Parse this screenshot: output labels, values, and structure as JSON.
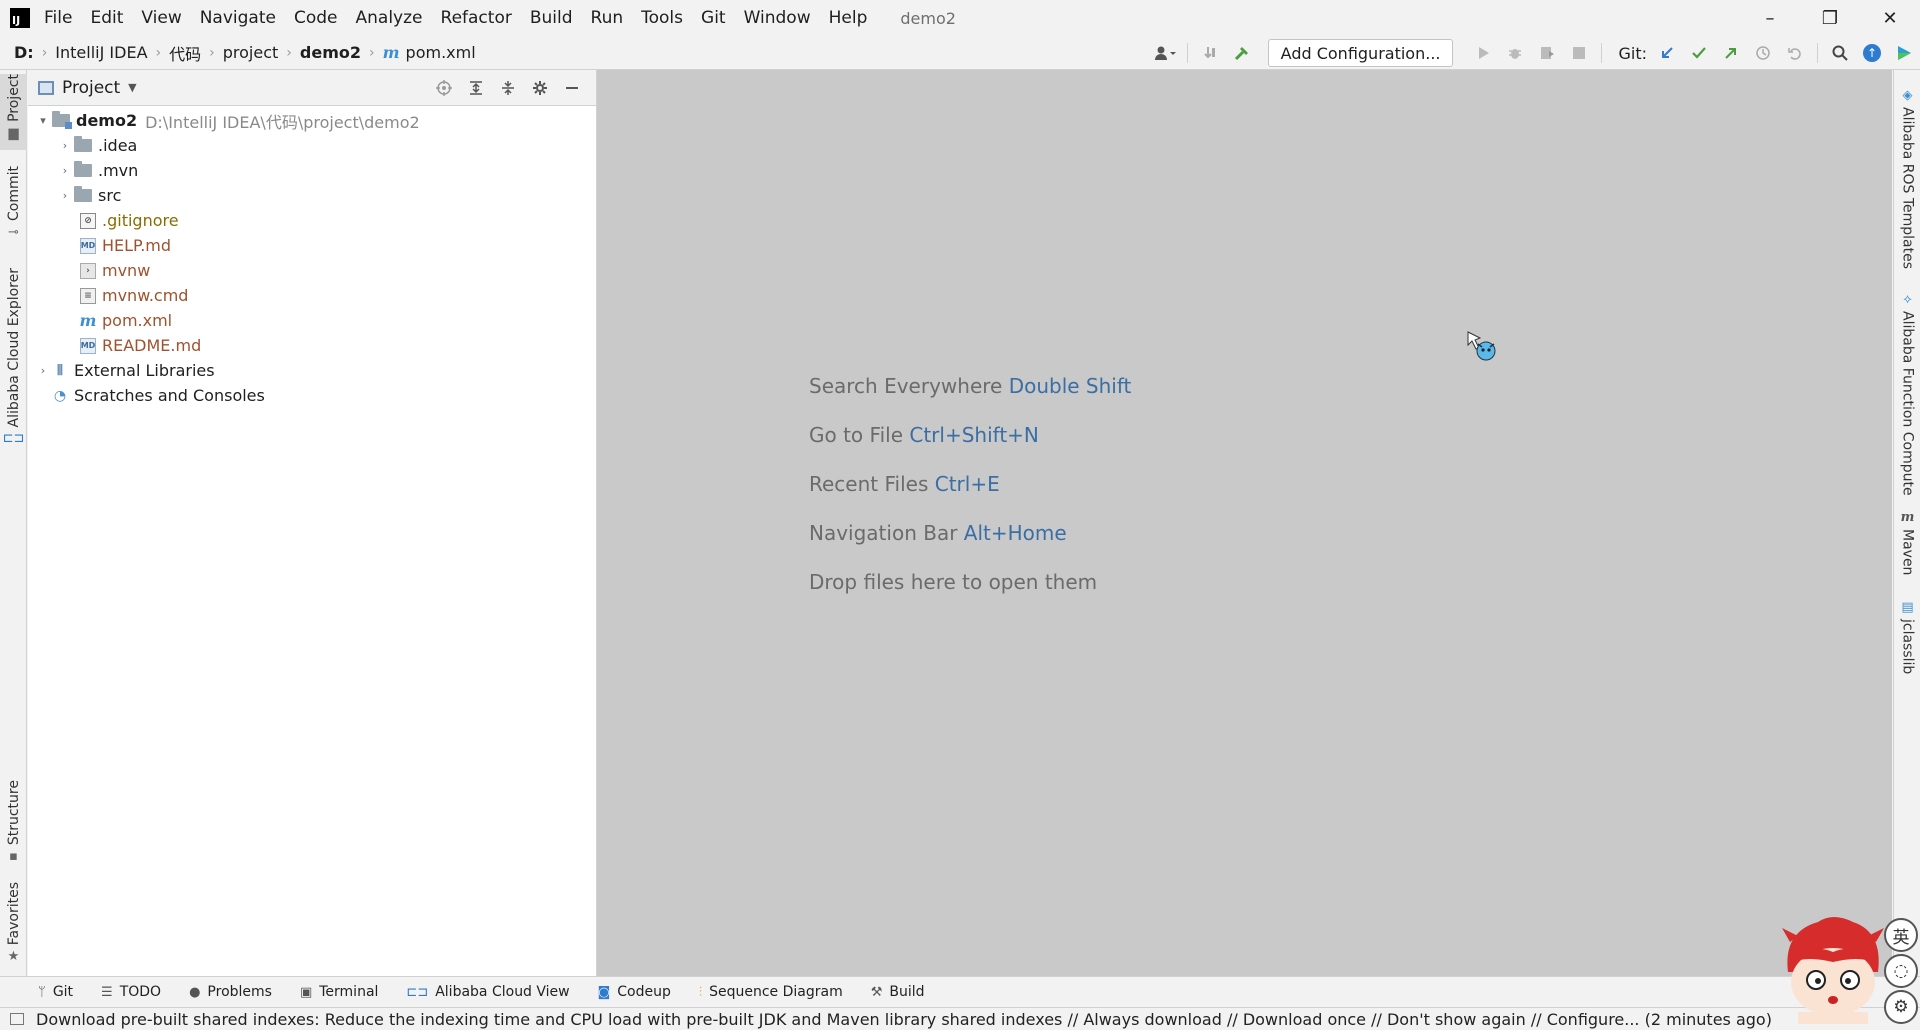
{
  "window": {
    "menus": [
      "File",
      "Edit",
      "View",
      "Navigate",
      "Code",
      "Analyze",
      "Refactor",
      "Build",
      "Run",
      "Tools",
      "Git",
      "Window",
      "Help"
    ],
    "title": "demo2",
    "controls": {
      "minimize": "–",
      "restore": "❐",
      "close": "✕"
    }
  },
  "navbar": {
    "breadcrumb": [
      "D:",
      "IntelliJ IDEA",
      "代码",
      "project",
      "demo2",
      "pom.xml"
    ],
    "add_configuration": "Add Configuration...",
    "git_label": "Git:"
  },
  "left_stripe": {
    "tabs": [
      "Project",
      "Commit",
      "Alibaba Cloud Explorer",
      "Structure",
      "Favorites"
    ]
  },
  "right_stripe": {
    "tabs": [
      "Alibaba ROS Templates",
      "Alibaba Function Compute",
      "Maven",
      "jclasslib"
    ]
  },
  "project_panel": {
    "title": "Project",
    "root": {
      "name": "demo2",
      "path": "D:\\IntelliJ IDEA\\代码\\project\\demo2"
    },
    "items": [
      {
        "name": ".idea",
        "type": "folder"
      },
      {
        "name": ".mvn",
        "type": "folder"
      },
      {
        "name": "src",
        "type": "folder"
      },
      {
        "name": ".gitignore",
        "type": "file"
      },
      {
        "name": "HELP.md",
        "type": "file"
      },
      {
        "name": "mvnw",
        "type": "file"
      },
      {
        "name": "mvnw.cmd",
        "type": "file"
      },
      {
        "name": "pom.xml",
        "type": "file"
      },
      {
        "name": "README.md",
        "type": "file"
      }
    ],
    "external_libraries": "External Libraries",
    "scratches": "Scratches and Consoles"
  },
  "editor": {
    "hints": [
      {
        "text": "Search Everywhere",
        "key": "Double Shift"
      },
      {
        "text": "Go to File",
        "key": "Ctrl+Shift+N"
      },
      {
        "text": "Recent Files",
        "key": "Ctrl+E"
      },
      {
        "text": "Navigation Bar",
        "key": "Alt+Home"
      },
      {
        "text": "Drop files here to open them",
        "key": ""
      }
    ]
  },
  "bottom_tools": [
    "Git",
    "TODO",
    "Problems",
    "Terminal",
    "Alibaba Cloud View",
    "Codeup",
    "Sequence Diagram",
    "Build"
  ],
  "statusbar": {
    "message": "Download pre-built shared indexes: Reduce the indexing time and CPU load with pre-built JDK and Maven library shared indexes // Always download // Download once // Don't show again // Configure... (2 minutes ago)"
  },
  "ime": [
    "英"
  ]
}
